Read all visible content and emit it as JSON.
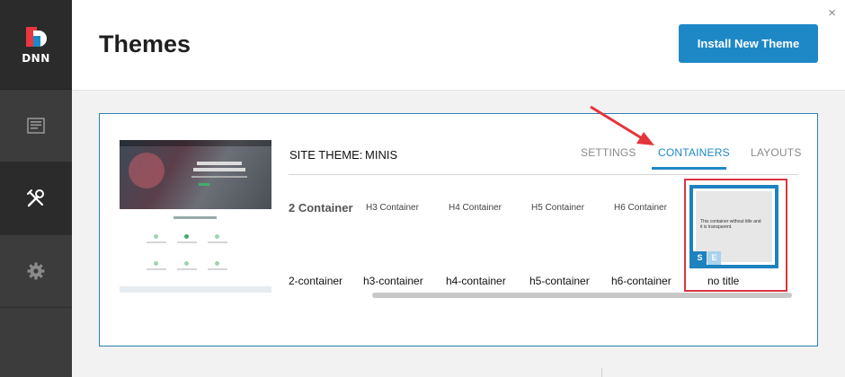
{
  "app": {
    "logo_text": "DNN"
  },
  "colors": {
    "accent": "#1e88c7",
    "sidebar": "#3c3c3c",
    "highlight": "#d9363e"
  },
  "sidebar": {
    "items": [
      {
        "icon": "content-icon",
        "active": false
      },
      {
        "icon": "tools-icon",
        "active": true
      },
      {
        "icon": "gear-icon",
        "active": false
      }
    ]
  },
  "header": {
    "title": "Themes",
    "install_button": "Install New Theme",
    "close": "×"
  },
  "panel": {
    "site_theme_label": "SITE THEME:",
    "site_theme_value": "MINIS",
    "tabs": [
      {
        "label": "SETTINGS",
        "active": false
      },
      {
        "label": "CONTAINERS",
        "active": true
      },
      {
        "label": "LAYOUTS",
        "active": false
      }
    ],
    "thumbnail": {
      "hero_line1": "Achieve Everything",
      "hero_line2": "You Can Imagine"
    },
    "containers": [
      {
        "title": "2 Container",
        "name": "2-container"
      },
      {
        "title": "H3 Container",
        "name": "h3-container"
      },
      {
        "title": "H4 Container",
        "name": "h4-container"
      },
      {
        "title": "H5 Container",
        "name": "h5-container"
      },
      {
        "title": "H6 Container",
        "name": "h6-container"
      },
      {
        "title": "",
        "name": "no title",
        "selected": true,
        "preview_text": "This container without title and it is transparent.",
        "tag_s": "S",
        "tag_e": "E"
      }
    ]
  }
}
